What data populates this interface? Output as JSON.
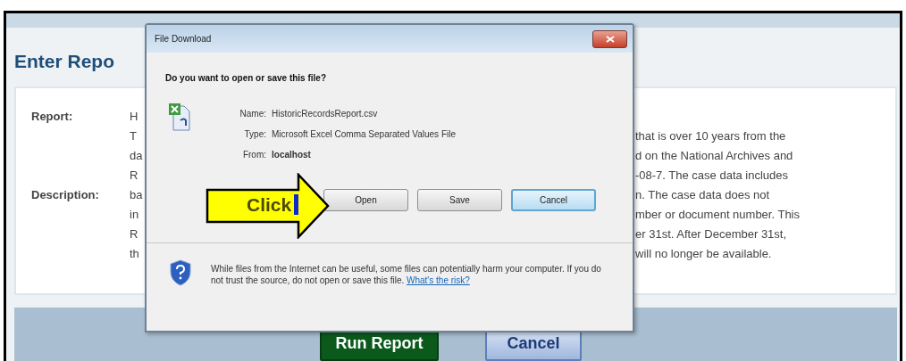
{
  "page": {
    "title": "Enter Repo",
    "rows": [
      {
        "label": "Report:",
        "left": "H"
      },
      {
        "left": "T",
        "right": "that is over 10 years from the"
      },
      {
        "left": "da",
        "right": "d on the National Archives and"
      },
      {
        "left": "R",
        "right": "-08-7. The case data includes"
      },
      {
        "label": "Description:",
        "left": "ba",
        "right": "n. The case data does not"
      },
      {
        "left": "in",
        "right": "mber or document number. This"
      },
      {
        "left": "R",
        "right": "er 31st. After December 31st,"
      },
      {
        "left": "th",
        "right": "will no longer be available."
      }
    ],
    "buttons": [
      {
        "label": "Run Report",
        "kind": "primary"
      },
      {
        "label": "Cancel",
        "kind": "secondary"
      }
    ]
  },
  "dialog": {
    "title": "File Download",
    "question": "Do you want to open or save this file?",
    "fields": [
      {
        "label": "Name:",
        "value": "HistoricRecordsReport.csv",
        "bold": false
      },
      {
        "label": "Type:",
        "value": "Microsoft Excel Comma Separated Values File",
        "bold": false
      },
      {
        "label": "From:",
        "value": "localhost",
        "bold": true
      }
    ],
    "buttons": [
      {
        "label": "Open",
        "focused": false
      },
      {
        "label": "Save",
        "focused": false
      },
      {
        "label": "Cancel",
        "focused": true
      }
    ],
    "warning": "While files from the Internet can be useful, some files can potentially harm your computer. If you do not trust the source, do not open or save this file.",
    "link": "What's the risk?"
  },
  "callout": {
    "label": "Click"
  }
}
